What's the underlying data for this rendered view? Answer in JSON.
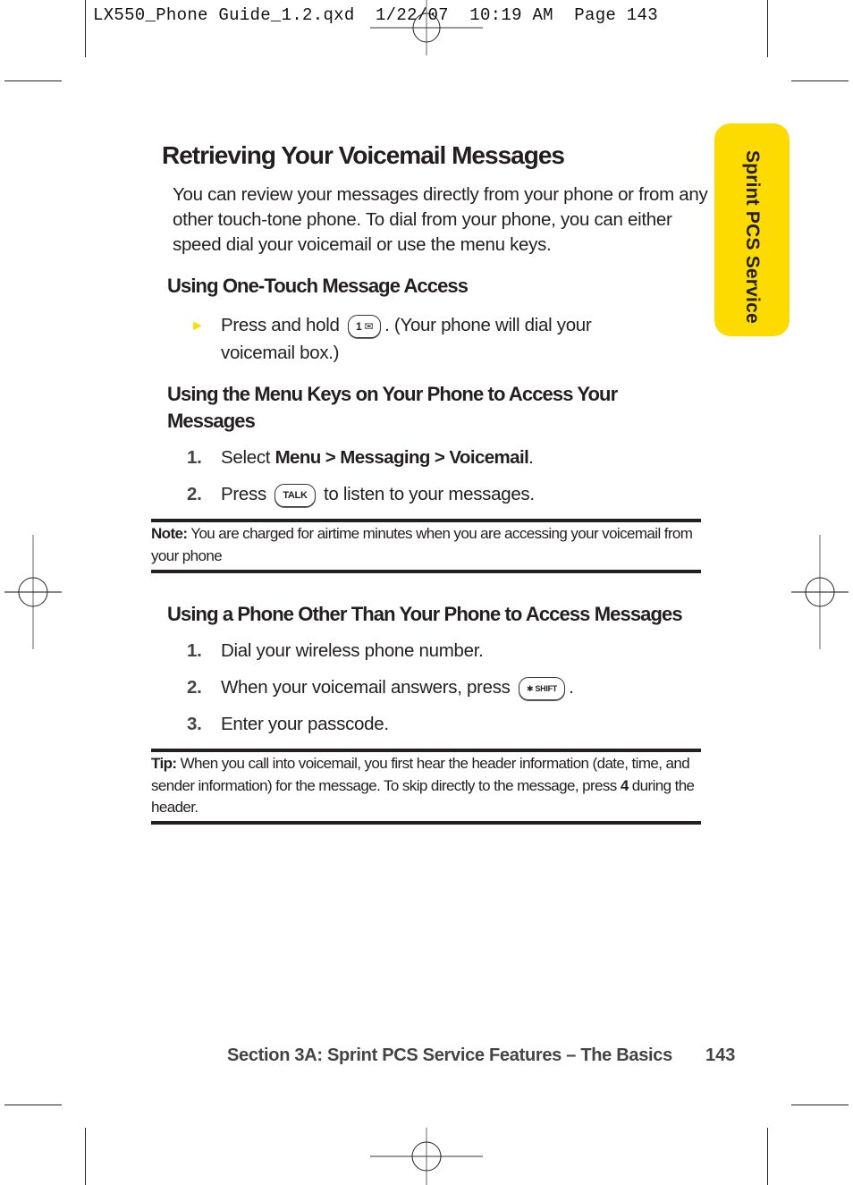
{
  "print_slug": "LX550_Phone Guide_1.2.qxd  1/22/07  10:19 AM  Page 143",
  "side_tab": {
    "label": "Sprint PCS Service",
    "color": "#fedb00"
  },
  "title": "Retrieving Your Voicemail Messages",
  "intro": "You can review your messages directly from your phone or from any other touch-tone phone. To dial from your phone, you can either speed dial your voicemail or use the menu keys.",
  "section1": {
    "heading": "Using One-Touch Message Access",
    "bullet": {
      "before": "Press and hold",
      "key_label": "1 ✉",
      "after": ". (Your phone will dial your voicemail box.)"
    }
  },
  "section2": {
    "heading": "Using the Menu Keys on Your Phone to Access Your Messages",
    "steps": [
      {
        "num": "1.",
        "before": "Select ",
        "bold": "Menu > Messaging > Voicemail",
        "after": "."
      },
      {
        "num": "2.",
        "before": "Press",
        "key_label": "TALK",
        "after": "to listen to your messages."
      }
    ],
    "note": {
      "label": "Note:",
      "text": " You are charged for airtime minutes when you are accessing your voicemail from your phone"
    }
  },
  "section3": {
    "heading": "Using a Phone Other Than Your Phone to Access Messages",
    "steps": [
      {
        "num": "1.",
        "text": "Dial your wireless phone number."
      },
      {
        "num": "2.",
        "before": "When your voicemail answers, press",
        "key_label": "✱ SHIFT",
        "after": "."
      },
      {
        "num": "3.",
        "text": "Enter your passcode."
      }
    ],
    "tip": {
      "label": "Tip:",
      "text_before": " When you call into voicemail, you first hear the header information (date, time, and sender information) for the message. To skip directly to the message, press ",
      "bold": "4",
      "text_after": " during the header."
    }
  },
  "footer": {
    "section": "Section 3A: Sprint PCS Service Features – The Basics",
    "page": "143"
  }
}
